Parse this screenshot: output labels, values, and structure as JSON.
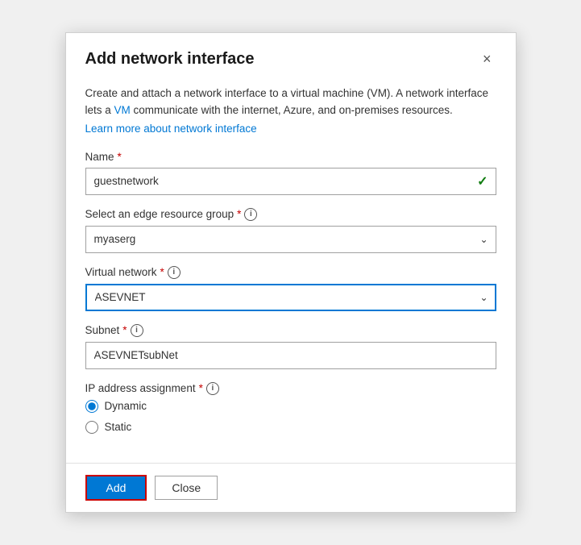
{
  "dialog": {
    "title": "Add network interface",
    "close_label": "×"
  },
  "description": {
    "text": "Create and attach a network interface to a virtual machine (VM). A network interface lets a VM communicate with the internet, Azure, and on-premises resources.",
    "link_text": "Learn more about network interface"
  },
  "form": {
    "name_label": "Name",
    "name_value": "guestnetwork",
    "resource_group_label": "Select an edge resource group",
    "resource_group_value": "myaserg",
    "virtual_network_label": "Virtual network",
    "virtual_network_value": "ASEVNET",
    "subnet_label": "Subnet",
    "subnet_value": "ASEVNETsubNet",
    "ip_assignment_label": "IP address assignment",
    "ip_options": [
      {
        "id": "dynamic",
        "label": "Dynamic",
        "checked": true
      },
      {
        "id": "static",
        "label": "Static",
        "checked": false
      }
    ]
  },
  "footer": {
    "add_label": "Add",
    "close_label": "Close"
  },
  "icons": {
    "info": "i",
    "check": "✓",
    "chevron": "⌄",
    "close": "✕"
  }
}
